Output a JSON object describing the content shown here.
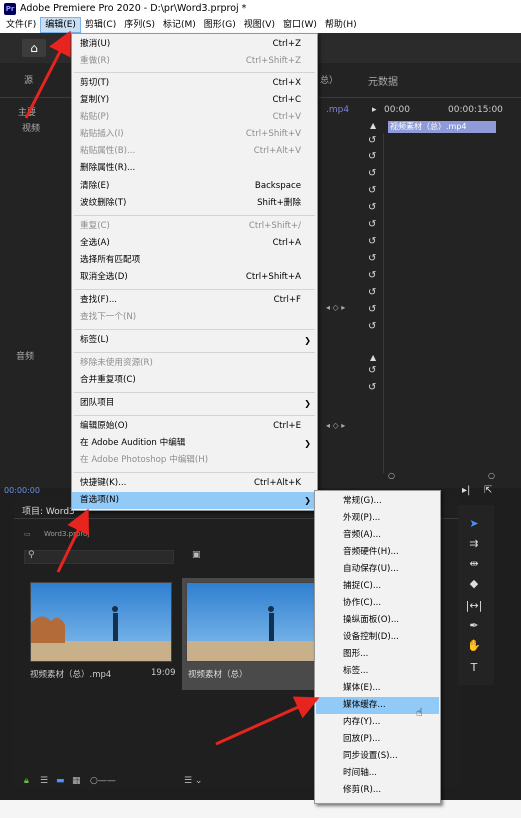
{
  "window": {
    "title": "Adobe Premiere Pro 2020 - D:\\pr\\Word3.prproj *",
    "logo": "Pr"
  },
  "menubar": [
    "文件(F)",
    "编辑(E)",
    "剪辑(C)",
    "序列(S)",
    "标记(M)",
    "图形(G)",
    "视图(V)",
    "窗口(W)",
    "帮助(H)"
  ],
  "top_panel": {
    "tab_right": "总）",
    "metadata_tab": "元数据",
    "clip_name": ".mp4",
    "time_start": "00:00",
    "time_end": "00:00:15:00",
    "clip_label": "视频素材（总）.mp4",
    "left_frag1": "源",
    "left_frag2": "主要",
    "left_frag3": "视频",
    "left_frag4": "音频",
    "timecode": "00:00:00"
  },
  "edit_menu": [
    {
      "label": "撤消(U)",
      "shortcut": "Ctrl+Z",
      "disabled": false
    },
    {
      "label": "重做(R)",
      "shortcut": "Ctrl+Shift+Z",
      "disabled": true
    },
    {
      "label": "剪切(T)",
      "shortcut": "Ctrl+X",
      "disabled": false
    },
    {
      "label": "复制(Y)",
      "shortcut": "Ctrl+C",
      "disabled": false
    },
    {
      "label": "粘贴(P)",
      "shortcut": "Ctrl+V",
      "disabled": true
    },
    {
      "label": "粘贴插入(I)",
      "shortcut": "Ctrl+Shift+V",
      "disabled": true
    },
    {
      "label": "粘贴属性(B)...",
      "shortcut": "Ctrl+Alt+V",
      "disabled": true
    },
    {
      "label": "删除属性(R)...",
      "shortcut": "",
      "disabled": false
    },
    {
      "label": "清除(E)",
      "shortcut": "Backspace",
      "disabled": false
    },
    {
      "label": "波纹删除(T)",
      "shortcut": "Shift+删除",
      "disabled": false
    },
    {
      "label": "重复(C)",
      "shortcut": "Ctrl+Shift+/",
      "disabled": true
    },
    {
      "label": "全选(A)",
      "shortcut": "Ctrl+A",
      "disabled": false
    },
    {
      "label": "选择所有匹配项",
      "shortcut": "",
      "disabled": false
    },
    {
      "label": "取消全选(D)",
      "shortcut": "Ctrl+Shift+A",
      "disabled": false
    },
    {
      "label": "查找(F)...",
      "shortcut": "Ctrl+F",
      "disabled": false
    },
    {
      "label": "查找下一个(N)",
      "shortcut": "",
      "disabled": true
    },
    {
      "label": "标签(L)",
      "shortcut": "",
      "disabled": false
    },
    {
      "label": "移除未使用资源(R)",
      "shortcut": "",
      "disabled": true
    },
    {
      "label": "合并重复项(C)",
      "shortcut": "",
      "disabled": false
    },
    {
      "label": "团队项目",
      "shortcut": "",
      "disabled": false
    },
    {
      "label": "编辑原始(O)",
      "shortcut": "Ctrl+E",
      "disabled": false
    },
    {
      "label": "在 Adobe Audition 中编辑",
      "shortcut": "",
      "disabled": false
    },
    {
      "label": "在 Adobe Photoshop 中编辑(H)",
      "shortcut": "",
      "disabled": true
    },
    {
      "label": "快捷键(K)...",
      "shortcut": "Ctrl+Alt+K",
      "disabled": false
    },
    {
      "label": "首选项(N)",
      "shortcut": "",
      "disabled": false
    }
  ],
  "prefs_submenu": [
    "常规(G)...",
    "外观(P)...",
    "音频(A)...",
    "音频硬件(H)...",
    "自动保存(U)...",
    "捕捉(C)...",
    "协作(C)...",
    "操纵面板(O)...",
    "设备控制(D)...",
    "图形...",
    "标签...",
    "媒体(E)...",
    "媒体缓存...",
    "内存(Y)...",
    "回放(P)...",
    "同步设置(S)...",
    "时间轴...",
    "修剪(R)..."
  ],
  "project_panel": {
    "tab": "项目: Word3",
    "file": "Word3.prproj",
    "clip1_name": "视频素材（总）.mp4",
    "clip1_duration": "19:09",
    "clip2_name": "视频素材（总）"
  },
  "colors": {
    "highlight": "#91c9f7",
    "arrow": "#e8241e",
    "timeline_clip": "#8f9bd8"
  }
}
